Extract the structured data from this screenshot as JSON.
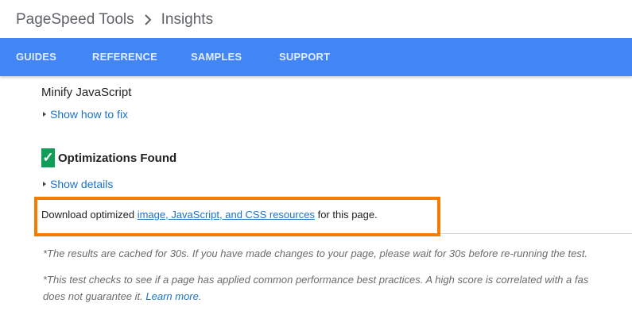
{
  "breadcrumb": {
    "root": "PageSpeed Tools",
    "separator_icon": "chevron-right-icon",
    "current": "Insights"
  },
  "nav": {
    "color": "#4285f4",
    "items": [
      {
        "label": "GUIDES"
      },
      {
        "label": "REFERENCE"
      },
      {
        "label": "SAMPLES"
      },
      {
        "label": "SUPPORT"
      }
    ]
  },
  "rule": {
    "title": "Minify JavaScript",
    "show_fix_label": "Show how to fix"
  },
  "optimizations": {
    "check_icon": "check-mark-icon",
    "check_color": "#0f9d58",
    "heading": "Optimizations Found",
    "show_details_label": "Show details"
  },
  "download": {
    "prefix": "Download optimized ",
    "link_text": "image, JavaScript, and CSS resources",
    "suffix": " for this page."
  },
  "highlight_color": "#f57c00",
  "notes": {
    "cache_note": "*The results are cached for 30s. If you have made changes to your page, please wait for 30s before re-running the test.",
    "test_note_line1": "*This test checks to see if a page has applied common performance best practices. A high score is correlated with a fas",
    "test_note_line2": "does not guarantee it. ",
    "learn_more": "Learn more",
    "learn_more_suffix": "."
  }
}
